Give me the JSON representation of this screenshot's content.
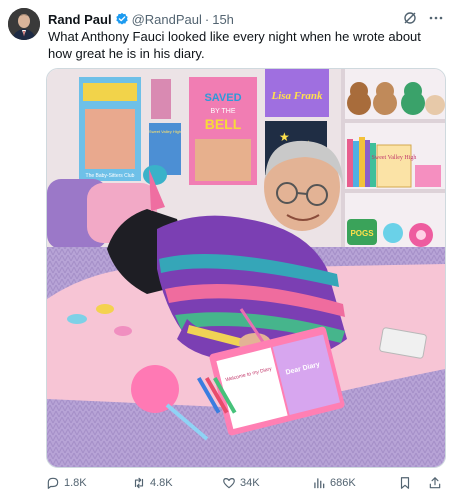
{
  "post": {
    "author_name": "Rand Paul",
    "handle": "@RandPaul",
    "separator": "·",
    "time": "15h",
    "text": "What Anthony Fauci looked like every night when he wrote about how great he is in his diary.",
    "icons": {
      "verified": "verified-badge-icon",
      "grok": "grok-icon",
      "more": "more-icon"
    }
  },
  "media": {
    "poster_saved": [
      "SAVED",
      "BY THE",
      "BELL"
    ],
    "poster_lisa": "Lisa Frank",
    "poster_babysitters": "The Baby-Sitters Club",
    "poster_sweet": "Sweet Valley High",
    "book_sweet": "Sweet Valley High",
    "pogs_label": "POGS",
    "diary_title": "Dear Diary",
    "page_note": "Welcome to my Diary"
  },
  "actions": {
    "replies": "1.8K",
    "reposts": "4.8K",
    "likes": "34K",
    "views": "686K"
  },
  "colors": {
    "text_primary": "#0f1419",
    "text_secondary": "#536471",
    "verified": "#1d9bf0"
  }
}
